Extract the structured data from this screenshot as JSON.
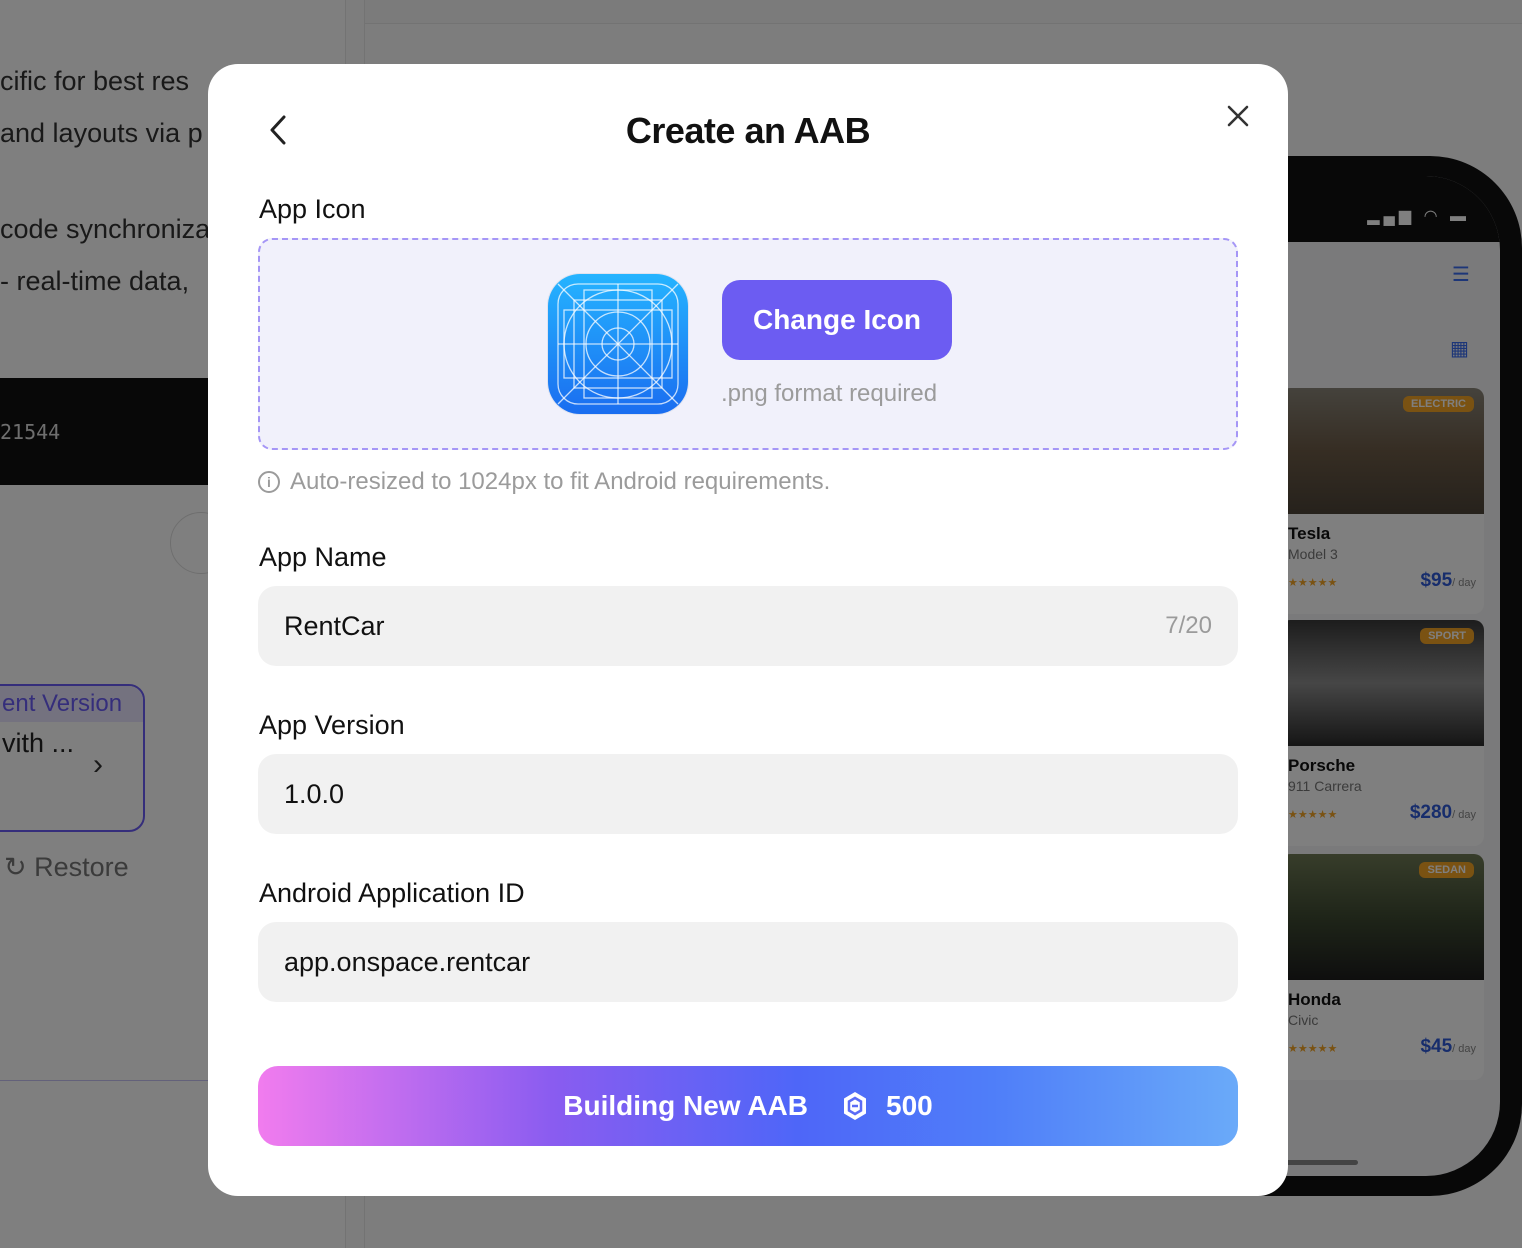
{
  "background": {
    "chat_lines": [
      "cific for best res",
      "and layouts via p",
      "code synchroniza",
      " - real-time data,"
    ],
    "code_text": "21544",
    "version_card": {
      "header": "ent Version",
      "text": "vith ..."
    },
    "restore_label": "Restore",
    "phone": {
      "cars": [
        {
          "badge": "ELECTRIC",
          "name": "Tesla",
          "model": "Model 3",
          "price": "$95",
          "unit": "/ day"
        },
        {
          "badge": "SPORT",
          "name": "Porsche",
          "model": "911 Carrera",
          "price": "$280",
          "unit": "/ day"
        },
        {
          "badge": "SEDAN",
          "name": "Honda",
          "model": "Civic",
          "price": "$45",
          "unit": "/ day"
        }
      ]
    }
  },
  "modal": {
    "title": "Create an AAB",
    "app_icon": {
      "label": "App Icon",
      "change_button": "Change Icon",
      "format_hint": ".png format required",
      "note": "Auto-resized to 1024px to fit Android requirements."
    },
    "app_name": {
      "label": "App Name",
      "value": "RentCar",
      "counter": "7/20"
    },
    "app_version": {
      "label": "App Version",
      "value": "1.0.0"
    },
    "application_id": {
      "label": "Android Application ID",
      "value": "app.onspace.rentcar"
    },
    "build_button": {
      "label": "Building New AAB",
      "cost": "500"
    }
  },
  "colors": {
    "accent": "#6c5cf2",
    "dropzone_border": "#a596f6",
    "price_blue": "#2f5bd8"
  },
  "icons": [
    "back-icon",
    "close-icon",
    "info-icon",
    "coin-icon",
    "filter-icon",
    "list-icon"
  ]
}
